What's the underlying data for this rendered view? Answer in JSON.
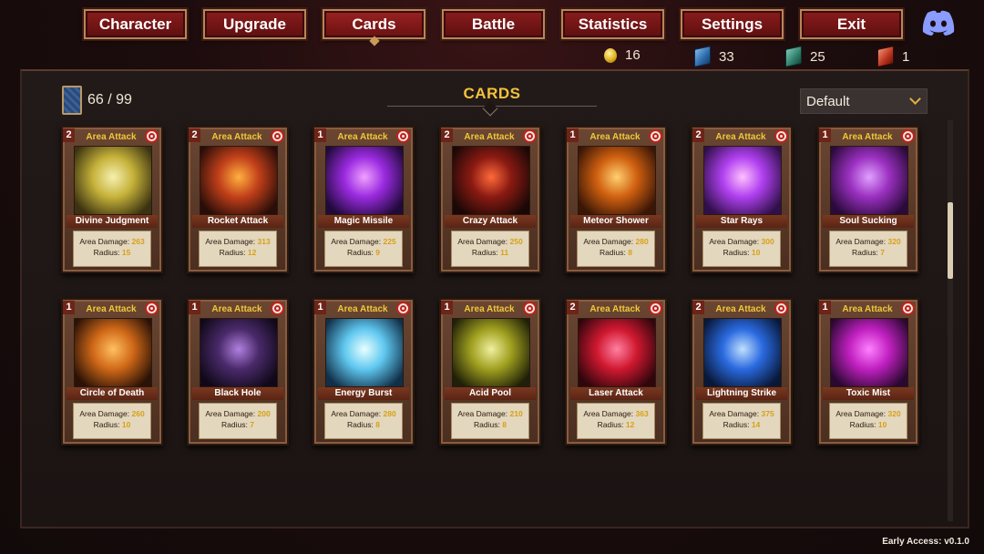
{
  "nav": [
    {
      "label": "Character",
      "active": false
    },
    {
      "label": "Upgrade",
      "active": false
    },
    {
      "label": "Cards",
      "active": true
    },
    {
      "label": "Battle",
      "active": false
    },
    {
      "label": "Statistics",
      "active": false
    },
    {
      "label": "Settings",
      "active": false
    },
    {
      "label": "Exit",
      "active": false
    }
  ],
  "currencies": {
    "coins": "16",
    "blue_books": "33",
    "green_books": "25",
    "red_books": "1"
  },
  "collection": {
    "count": "66 / 99"
  },
  "title": "CARDS",
  "sort": {
    "selected": "Default"
  },
  "card_stat_labels": {
    "damage": "Area Damage:",
    "radius": "Radius:"
  },
  "cards": [
    {
      "count": "2",
      "type": "Area Attack",
      "name": "Divine Judgment",
      "damage": "263",
      "radius": "15",
      "art": [
        "#f6f0b0",
        "#c6b23a",
        "#3a3210"
      ]
    },
    {
      "count": "2",
      "type": "Area Attack",
      "name": "Rocket Attack",
      "damage": "313",
      "radius": "12",
      "art": [
        "#ffb040",
        "#c2401a",
        "#2a0d08"
      ]
    },
    {
      "count": "1",
      "type": "Area Attack",
      "name": "Magic Missile",
      "damage": "225",
      "radius": "9",
      "art": [
        "#f0a0ff",
        "#9a2ae0",
        "#200a3a"
      ]
    },
    {
      "count": "2",
      "type": "Area Attack",
      "name": "Crazy Attack",
      "damage": "250",
      "radius": "11",
      "art": [
        "#ff6a3a",
        "#8a1a12",
        "#1a0806"
      ]
    },
    {
      "count": "1",
      "type": "Area Attack",
      "name": "Meteor Shower",
      "damage": "280",
      "radius": "8",
      "art": [
        "#ffd070",
        "#d06010",
        "#3a1606"
      ]
    },
    {
      "count": "2",
      "type": "Area Attack",
      "name": "Star Rays",
      "damage": "300",
      "radius": "10",
      "art": [
        "#ffc0ff",
        "#b040f0",
        "#30104a"
      ]
    },
    {
      "count": "1",
      "type": "Area Attack",
      "name": "Soul Sucking",
      "damage": "320",
      "radius": "7",
      "art": [
        "#e0a0ff",
        "#9a30c0",
        "#2a0a3a"
      ]
    },
    {
      "count": "1",
      "type": "Area Attack",
      "name": "Circle of Death",
      "damage": "260",
      "radius": "10",
      "art": [
        "#ffc060",
        "#d06818",
        "#2a1206"
      ]
    },
    {
      "count": "1",
      "type": "Area Attack",
      "name": "Black Hole",
      "damage": "200",
      "radius": "7",
      "art": [
        "#b080e0",
        "#4a2a6a",
        "#100818"
      ]
    },
    {
      "count": "1",
      "type": "Area Attack",
      "name": "Energy Burst",
      "damage": "280",
      "radius": "8",
      "art": [
        "#e8ffff",
        "#60c8f0",
        "#10304a"
      ]
    },
    {
      "count": "1",
      "type": "Area Attack",
      "name": "Acid Pool",
      "damage": "210",
      "radius": "8",
      "art": [
        "#f0f0a0",
        "#a0a020",
        "#202008"
      ]
    },
    {
      "count": "2",
      "type": "Area Attack",
      "name": "Laser Attack",
      "damage": "363",
      "radius": "12",
      "art": [
        "#ff80a0",
        "#d01830",
        "#30060c"
      ]
    },
    {
      "count": "2",
      "type": "Area Attack",
      "name": "Lightning Strike",
      "damage": "375",
      "radius": "14",
      "art": [
        "#c0e0ff",
        "#2a6ae0",
        "#081838"
      ]
    },
    {
      "count": "1",
      "type": "Area Attack",
      "name": "Toxic Mist",
      "damage": "320",
      "radius": "10",
      "art": [
        "#ff80ff",
        "#c020c0",
        "#2a0830"
      ]
    }
  ],
  "version": "Early Access: v0.1.0"
}
